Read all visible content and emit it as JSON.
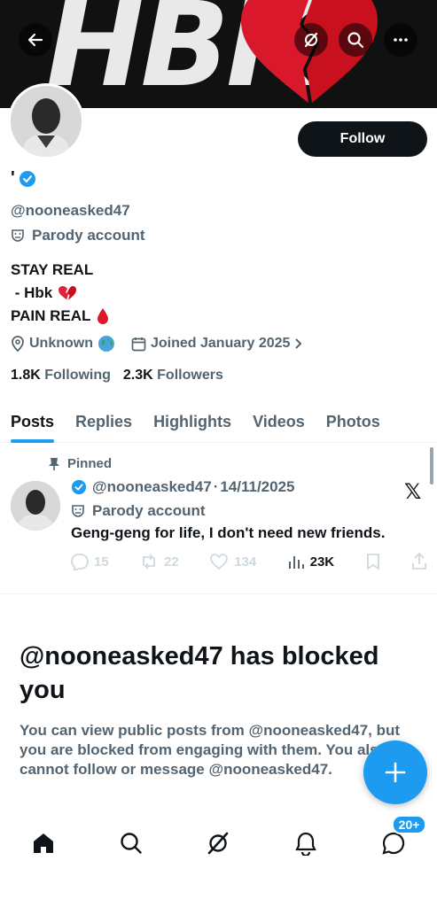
{
  "banner": {
    "text": "HBK"
  },
  "header": {
    "back": "back-arrow",
    "grok": "grok-icon",
    "search": "search-icon",
    "more": "more-icon"
  },
  "profile": {
    "name": "'",
    "follow_label": "Follow",
    "handle": "@nooneasked47",
    "parody_label": "Parody account",
    "bio": [
      "STAY REAL",
      " - Hbk",
      "PAIN REAL"
    ],
    "location": "Unknown",
    "joined": "Joined January 2025",
    "following_count": "1.8K",
    "following_label": "Following",
    "followers_count": "2.3K",
    "followers_label": "Followers"
  },
  "tabs": [
    "Posts",
    "Replies",
    "Highlights",
    "Videos",
    "Photos"
  ],
  "pinned_post": {
    "pinned_label": "Pinned",
    "handle": "@nooneasked47",
    "separator": "·",
    "date": "14/11/2025",
    "parody_label": "Parody account",
    "text": "Geng-geng for life, I don't need new friends.",
    "replies": "15",
    "reposts": "22",
    "likes": "134",
    "views": "23K"
  },
  "blocked": {
    "title": "@nooneasked47 has blocked you",
    "body": "You can view public posts from @nooneasked47, but you are blocked from engaging with them. You also cannot follow or message @nooneasked47."
  },
  "nav": {
    "messages_badge": "20+"
  },
  "colors": {
    "accent": "#1d9bf0",
    "text": "#0f1419",
    "muted": "#536471",
    "heart": "#d9182b"
  }
}
